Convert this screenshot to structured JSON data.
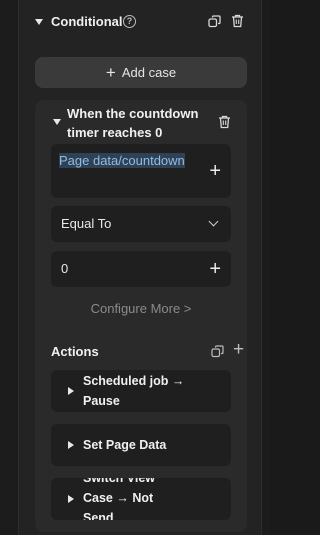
{
  "conditional": {
    "title": "Conditional",
    "help": "?"
  },
  "add_case": {
    "label": "Add case",
    "plus": "+"
  },
  "case": {
    "title": "When the countdown timer reaches 0",
    "data_field": "Page data/countdown",
    "operator": "Equal To",
    "value": "0",
    "configure_more": "Configure More  >",
    "plus": "+"
  },
  "actions": {
    "label": "Actions",
    "items": [
      {
        "label": "Scheduled job → Pause"
      },
      {
        "label": "Set Page Data"
      },
      {
        "label": "Switch View Case → Not Send"
      }
    ]
  },
  "colors": {
    "background": "#232323",
    "card": "#2a2a2a",
    "field": "#1f1f1f",
    "button": "#3a3a3a",
    "link": "#8fbde3"
  },
  "icons": [
    "caret-down-icon",
    "help-icon",
    "copy-icon",
    "trash-icon",
    "plus-icon",
    "chevron-down-icon",
    "chevron-right-icon",
    "caret-right-icon"
  ]
}
